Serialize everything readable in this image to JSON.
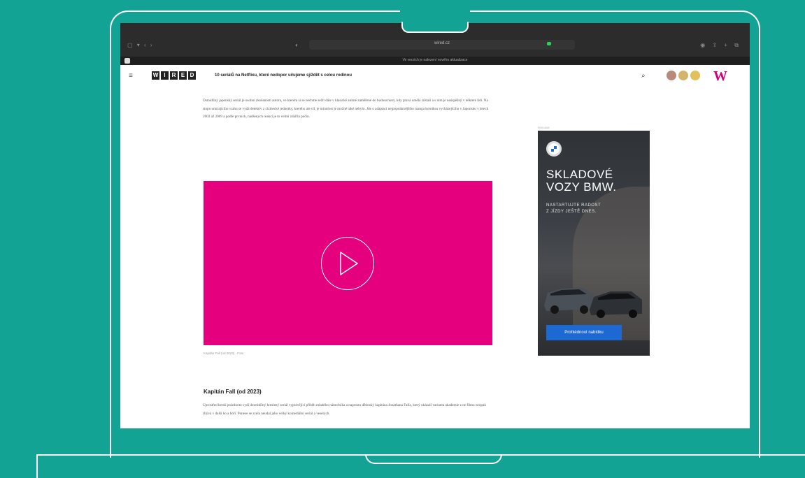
{
  "browser": {
    "url": "wired.cz",
    "banner": "Ve verzích je nalezení nového aktualizace"
  },
  "site": {
    "menu_icon": "menu-icon",
    "logo_letters": [
      "W",
      "I",
      "R",
      "E",
      "D"
    ],
    "headline": "10 seriálů na Netflixu, které nedopor učujeme sjíždět s celou rodinou",
    "search_icon": "search-icon",
    "brand_mark": "W",
    "accent": "#d4007a"
  },
  "article": {
    "intro": "Osmidílný japonský seriál je osobní zkušeností autora, ve kterém si se nechme sežít dále v klasické animé zaměřené do budoucnosti, kdy pravá umělá zůstalí a s ním je neúspěšný v některé lidi. Na stopu umírajícího vrahu se vydá detektiv z cizinecké jednotky, kterého ale cíl, je minulost je možné také nebylo. Jde o adaptaci nejpopulárnějšího manga komiksu vycházejícího v Japonsku v letech 2003 až 2009 a podle prvních, nadšených reakcí je to velmi zdařilá počin.",
    "video_caption": "Kapitán Fall (od 2023) · Foto",
    "section_title": "Kapitán Fall (od 2023)",
    "section_text": "Uprostřed kreslí prázdnotu vydí desetidílný kreslený seriál vyprávějící příběh mladého námořníka a naprosto dětinský kapitána Jonathana Falla, který ukázalí varianta akademie z ne filmu neopak zbývá v další ho a hoří. Ponese se zcela neudal jako velký komediální seriál a veselých."
  },
  "video": {
    "color": "#e5007e",
    "play_icon": "play-icon"
  },
  "ad": {
    "label": "REKLAMA",
    "title_line1": "SKLADOVÉ",
    "title_line2": "VOZY BMW.",
    "subtitle_line1": "NASTARTUJTE RADOST",
    "subtitle_line2": "Z JÍZDY JEŠTĚ DNES.",
    "cta": "Prohlédnout nabídku",
    "logo_icon": "bmw-logo-icon"
  }
}
